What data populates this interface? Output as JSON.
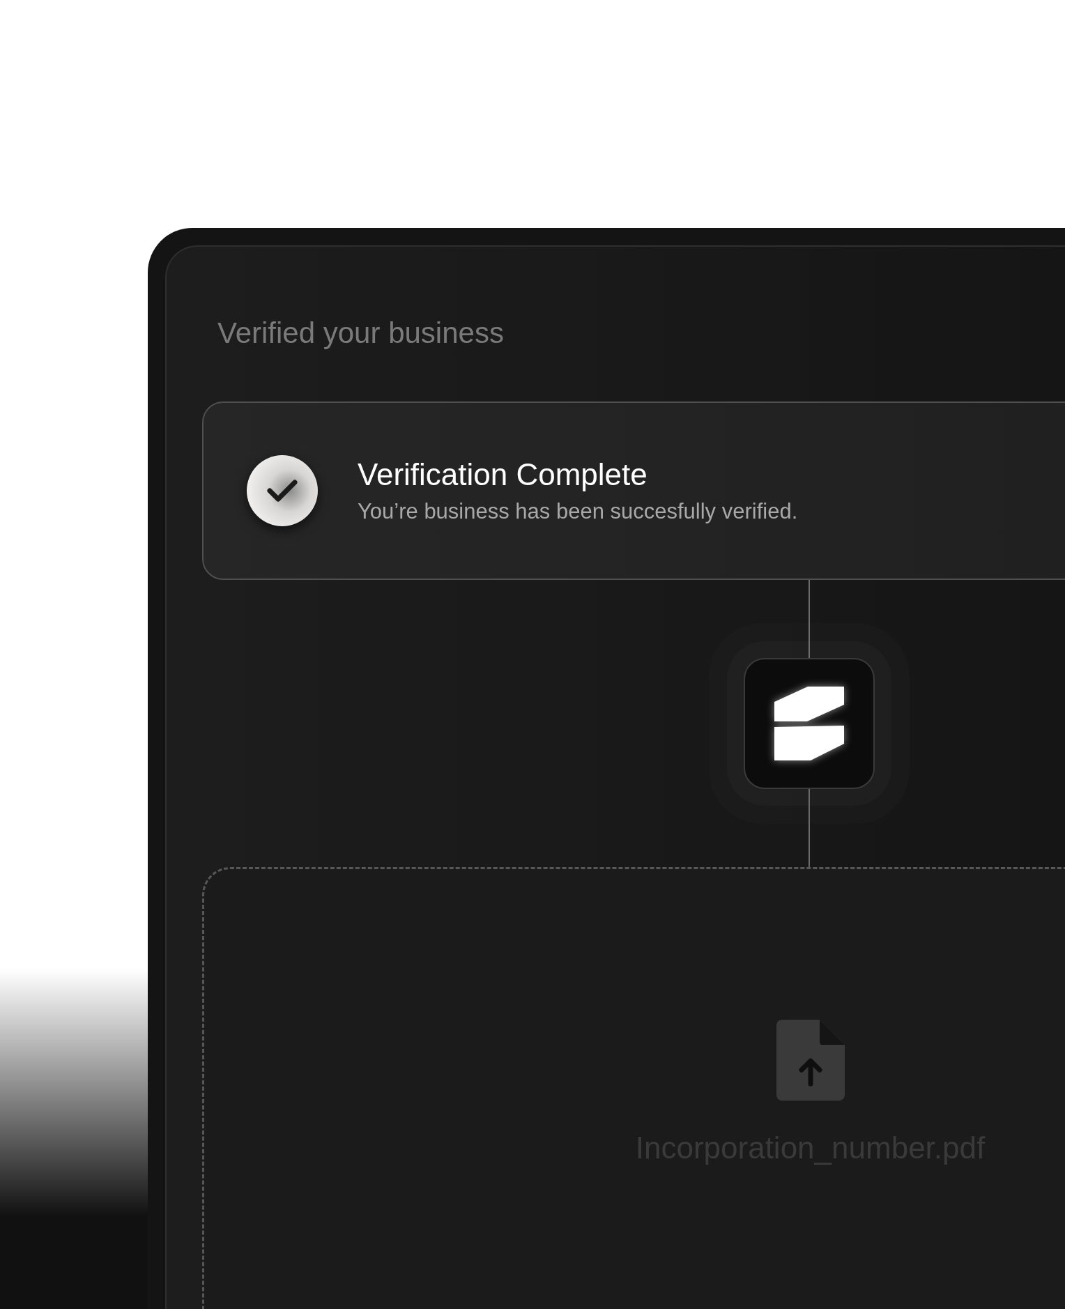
{
  "heading": "Verified your business",
  "status_card": {
    "title": "Verification Complete",
    "message": "You’re business has been succesfully verified."
  },
  "upload": {
    "filename": "Incorporation_number.pdf"
  }
}
